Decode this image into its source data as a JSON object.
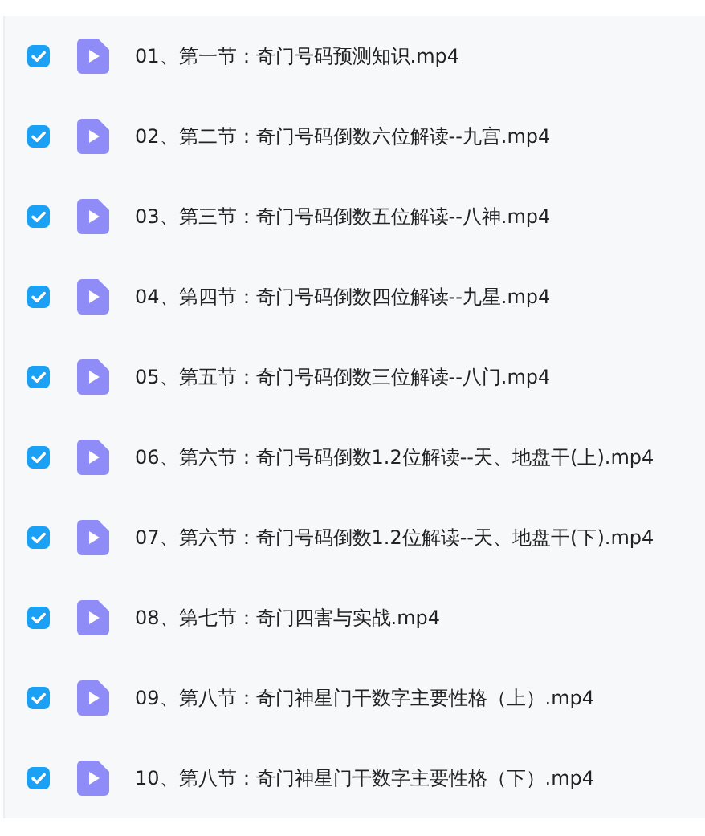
{
  "files": [
    {
      "name": "01、第一节：奇门号码预测知识.mp4",
      "checked": true
    },
    {
      "name": "02、第二节：奇门号码倒数六位解读--九宫.mp4",
      "checked": true
    },
    {
      "name": "03、第三节：奇门号码倒数五位解读--八神.mp4",
      "checked": true
    },
    {
      "name": "04、第四节：奇门号码倒数四位解读--九星.mp4",
      "checked": true
    },
    {
      "name": "05、第五节：奇门号码倒数三位解读--八门.mp4",
      "checked": true
    },
    {
      "name": "06、第六节：奇门号码倒数1.2位解读--天、地盘干(上).mp4",
      "checked": true
    },
    {
      "name": "07、第六节：奇门号码倒数1.2位解读--天、地盘干(下).mp4",
      "checked": true
    },
    {
      "name": "08、第七节：奇门四害与实战.mp4",
      "checked": true
    },
    {
      "name": "09、第八节：奇门神星门干数字主要性格（上）.mp4",
      "checked": true
    },
    {
      "name": "10、第八节：奇门神星门干数字主要性格（下）.mp4",
      "checked": true
    }
  ]
}
